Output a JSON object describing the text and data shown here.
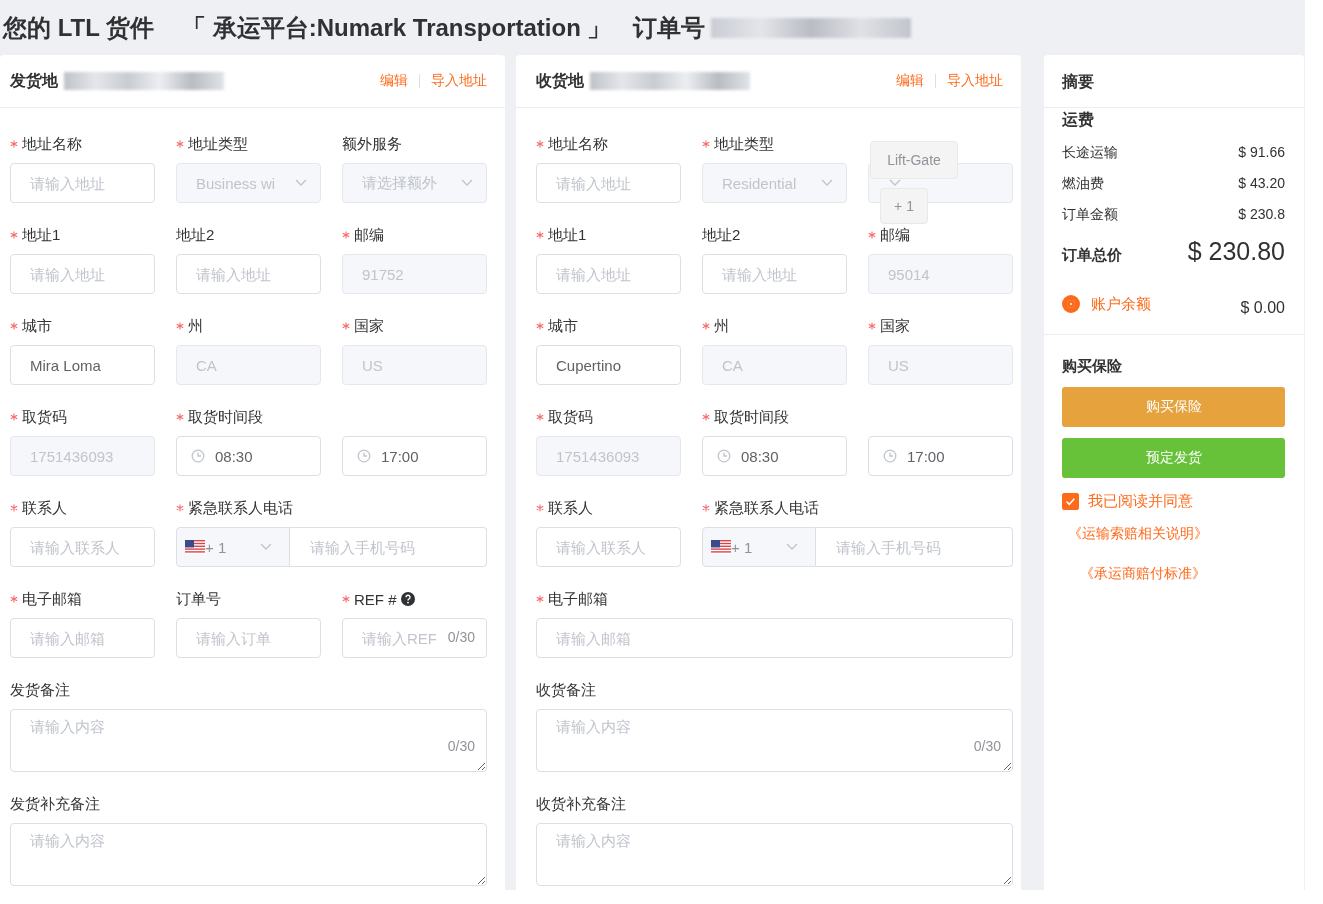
{
  "header": {
    "title": "您的 LTL 货件",
    "carrier": "「 承运平台:Numark Transportation 」",
    "order_label": "订单号"
  },
  "panels": [
    {
      "title": "发货地",
      "actions": [
        "编辑",
        "导入地址"
      ],
      "rows": [
        {
          "fields": [
            {
              "kind": "input",
              "label": "地址名称",
              "required": true,
              "placeholder": "请输入地址"
            },
            {
              "kind": "select",
              "label": "地址类型",
              "required": true,
              "value": "Business wi",
              "disabled": true
            },
            {
              "kind": "select",
              "label": "额外服务",
              "required": false,
              "placeholder": "请选择额外",
              "disabled": true
            }
          ]
        },
        {
          "fields": [
            {
              "kind": "input",
              "label": "地址1",
              "required": true,
              "placeholder": "请输入地址"
            },
            {
              "kind": "input",
              "label": "地址2",
              "required": false,
              "placeholder": "请输入地址"
            },
            {
              "kind": "input",
              "label": "邮编",
              "required": true,
              "value": "91752",
              "disabled": true
            }
          ]
        },
        {
          "fields": [
            {
              "kind": "input",
              "label": "城市",
              "required": true,
              "value": "Mira Loma"
            },
            {
              "kind": "input",
              "label": "州",
              "required": true,
              "value": "CA",
              "disabled": true
            },
            {
              "kind": "input",
              "label": "国家",
              "required": true,
              "value": "US",
              "disabled": true
            }
          ]
        },
        {
          "fields": [
            {
              "kind": "input",
              "label": "取货码",
              "required": true,
              "value": "1751436093",
              "disabled": true
            },
            {
              "kind": "time",
              "label": "取货时间段",
              "required": true,
              "value": "08:30"
            },
            {
              "kind": "time",
              "value": "17:00"
            }
          ]
        },
        {
          "fields": [
            {
              "kind": "input",
              "label": "联系人",
              "required": true,
              "placeholder": "请输入联系人"
            },
            {
              "kind": "phone",
              "label": "紧急联系人电话",
              "required": true,
              "code": "+ 1",
              "placeholder": "请输入手机号码"
            }
          ]
        },
        {
          "fields": [
            {
              "kind": "input",
              "label": "电子邮箱",
              "required": true,
              "placeholder": "请输入邮箱"
            },
            {
              "kind": "input",
              "label": "订单号",
              "required": false,
              "placeholder": "请输入订单"
            },
            {
              "kind": "counted",
              "label": "REF #",
              "required": true,
              "help": true,
              "placeholder": "请输入REF",
              "counter": "0/30"
            }
          ]
        },
        {
          "fields": [
            {
              "kind": "textarea",
              "label": "发货备注",
              "required": false,
              "placeholder": "请输入内容",
              "counter": "0/30"
            }
          ]
        },
        {
          "fields": [
            {
              "kind": "textarea",
              "label": "发货补充备注",
              "required": false,
              "placeholder": "请输入内容"
            }
          ]
        }
      ]
    },
    {
      "title": "收货地",
      "actions": [
        "编辑",
        "导入地址"
      ],
      "rows": [
        {
          "fields": [
            {
              "kind": "input",
              "label": "地址名称",
              "required": true,
              "placeholder": "请输入地址"
            },
            {
              "kind": "select",
              "label": "地址类型",
              "required": true,
              "value": "Residential",
              "disabled": true
            },
            {
              "kind": "select",
              "disabled": true,
              "tags": [
                "Lift-Gate",
                "+ 1"
              ]
            }
          ]
        },
        {
          "fields": [
            {
              "kind": "input",
              "label": "地址1",
              "required": true,
              "placeholder": "请输入地址"
            },
            {
              "kind": "input",
              "label": "地址2",
              "required": false,
              "placeholder": "请输入地址"
            },
            {
              "kind": "input",
              "label": "邮编",
              "required": true,
              "value": "95014",
              "disabled": true
            }
          ]
        },
        {
          "fields": [
            {
              "kind": "input",
              "label": "城市",
              "required": true,
              "value": "Cupertino"
            },
            {
              "kind": "input",
              "label": "州",
              "required": true,
              "value": "CA",
              "disabled": true
            },
            {
              "kind": "input",
              "label": "国家",
              "required": true,
              "value": "US",
              "disabled": true
            }
          ]
        },
        {
          "fields": [
            {
              "kind": "input",
              "label": "取货码",
              "required": true,
              "value": "1751436093",
              "disabled": true
            },
            {
              "kind": "time",
              "label": "取货时间段",
              "required": true,
              "value": "08:30"
            },
            {
              "kind": "time",
              "value": "17:00"
            }
          ]
        },
        {
          "fields": [
            {
              "kind": "input",
              "label": "联系人",
              "required": true,
              "placeholder": "请输入联系人"
            },
            {
              "kind": "phone",
              "label": "紧急联系人电话",
              "required": true,
              "code": "+ 1",
              "placeholder": "请输入手机号码"
            }
          ]
        },
        {
          "fields": [
            {
              "kind": "wide",
              "label": "电子邮箱",
              "required": true,
              "placeholder": "请输入邮箱"
            }
          ]
        },
        {
          "fields": [
            {
              "kind": "textarea",
              "label": "收货备注",
              "required": false,
              "placeholder": "请输入内容",
              "counter": "0/30"
            }
          ]
        },
        {
          "fields": [
            {
              "kind": "textarea",
              "label": "收货补充备注",
              "required": false,
              "placeholder": "请输入内容"
            }
          ]
        }
      ]
    }
  ],
  "summary": {
    "title": "摘要",
    "freight_title": "运费",
    "lines": [
      {
        "label": "长途运输",
        "value": "$ 91.66"
      },
      {
        "label": "燃油费",
        "value": "$ 43.20"
      },
      {
        "label": "订单金额",
        "value": "$ 230.8"
      }
    ],
    "total": {
      "label": "订单总价",
      "value": "$ 230.80"
    },
    "payment": {
      "label": "账户余额",
      "value": "$ 0.00",
      "selected": true
    },
    "insurance_title": "购买保险",
    "buttons": [
      {
        "label": "购买保险",
        "kind": "warning"
      },
      {
        "label": "预定发货",
        "kind": "success"
      }
    ],
    "agreement": {
      "label": "我已阅读并同意",
      "checked": true
    },
    "links": [
      "《运输索赔相关说明》",
      "《承运商赔付标准》"
    ]
  }
}
